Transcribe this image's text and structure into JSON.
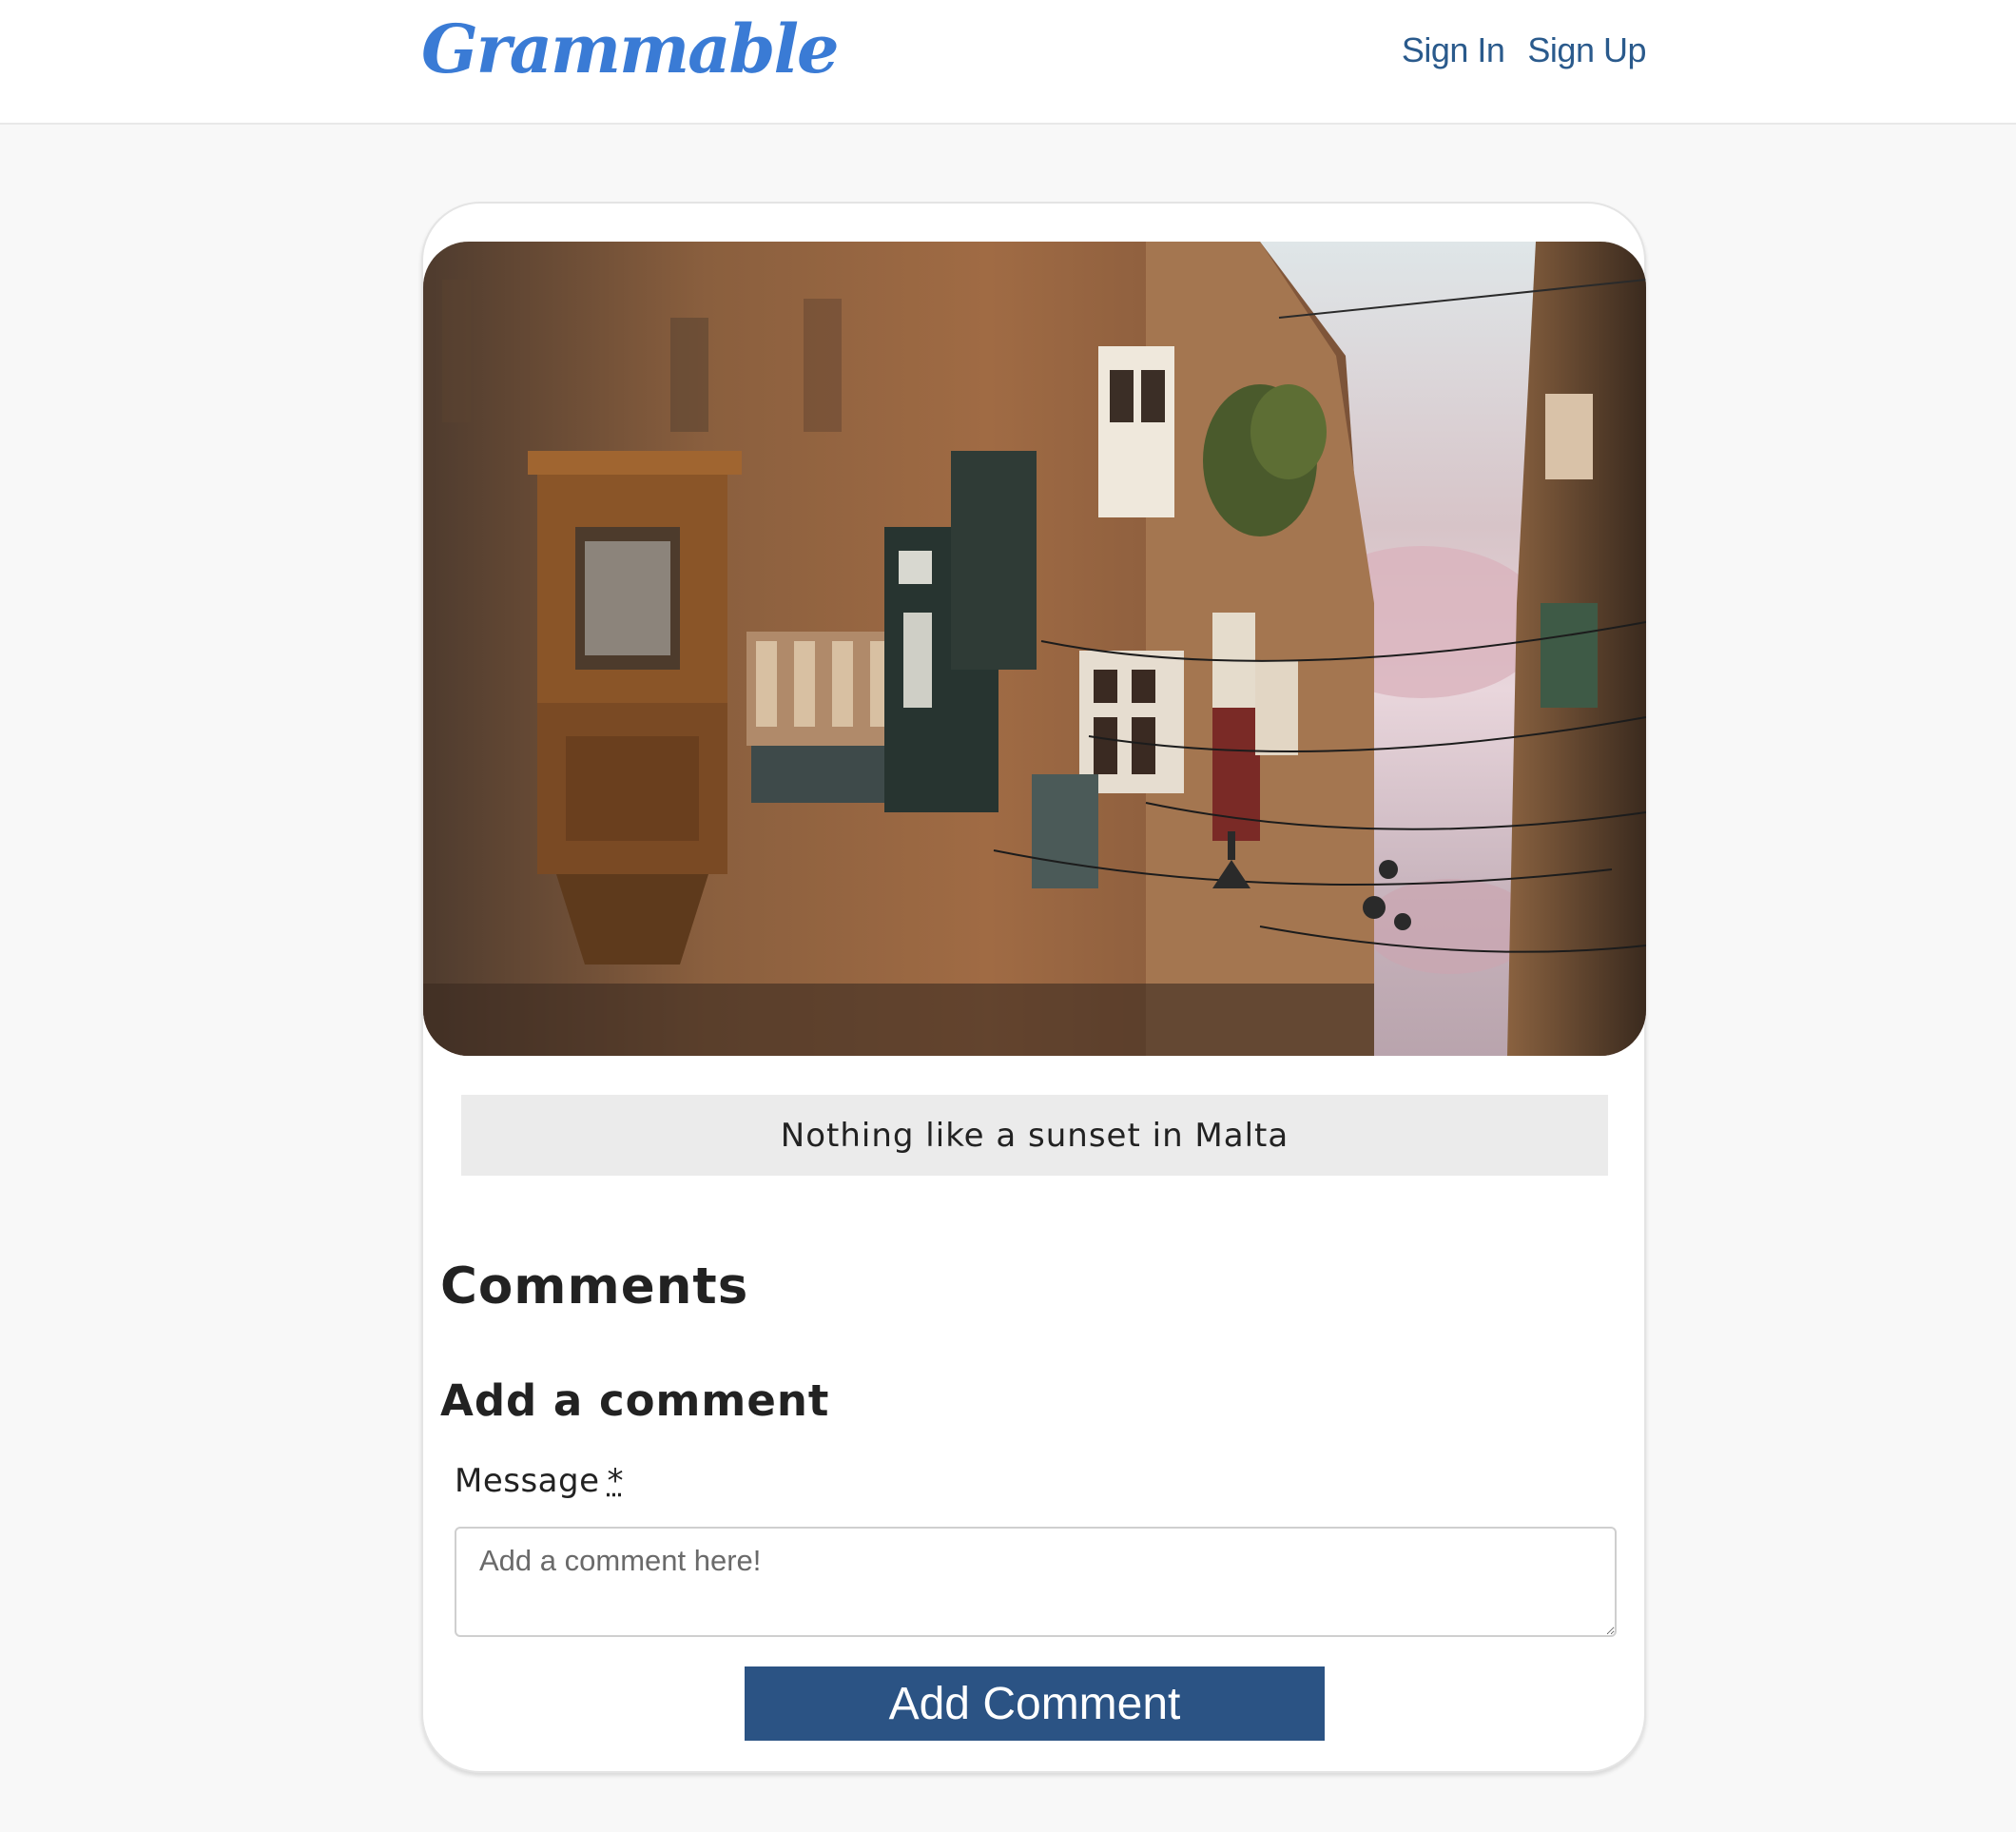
{
  "navbar": {
    "brand": "Grammable",
    "links": [
      "Sign In",
      "Sign Up"
    ]
  },
  "post": {
    "image_alt": "Narrow street lined with traditional enclosed wooden balconies at sunset",
    "caption": "Nothing like a sunset in Malta"
  },
  "comments": {
    "heading": "Comments",
    "form_heading": "Add a comment",
    "message_label": "Message",
    "required_marker": "*",
    "placeholder": "Add a comment here!",
    "submit_label": "Add Comment"
  },
  "colors": {
    "brand": "#3a7bd5",
    "nav_link": "#2a5a8c",
    "button": "#2b5384",
    "page_bg": "#f8f8f8"
  }
}
